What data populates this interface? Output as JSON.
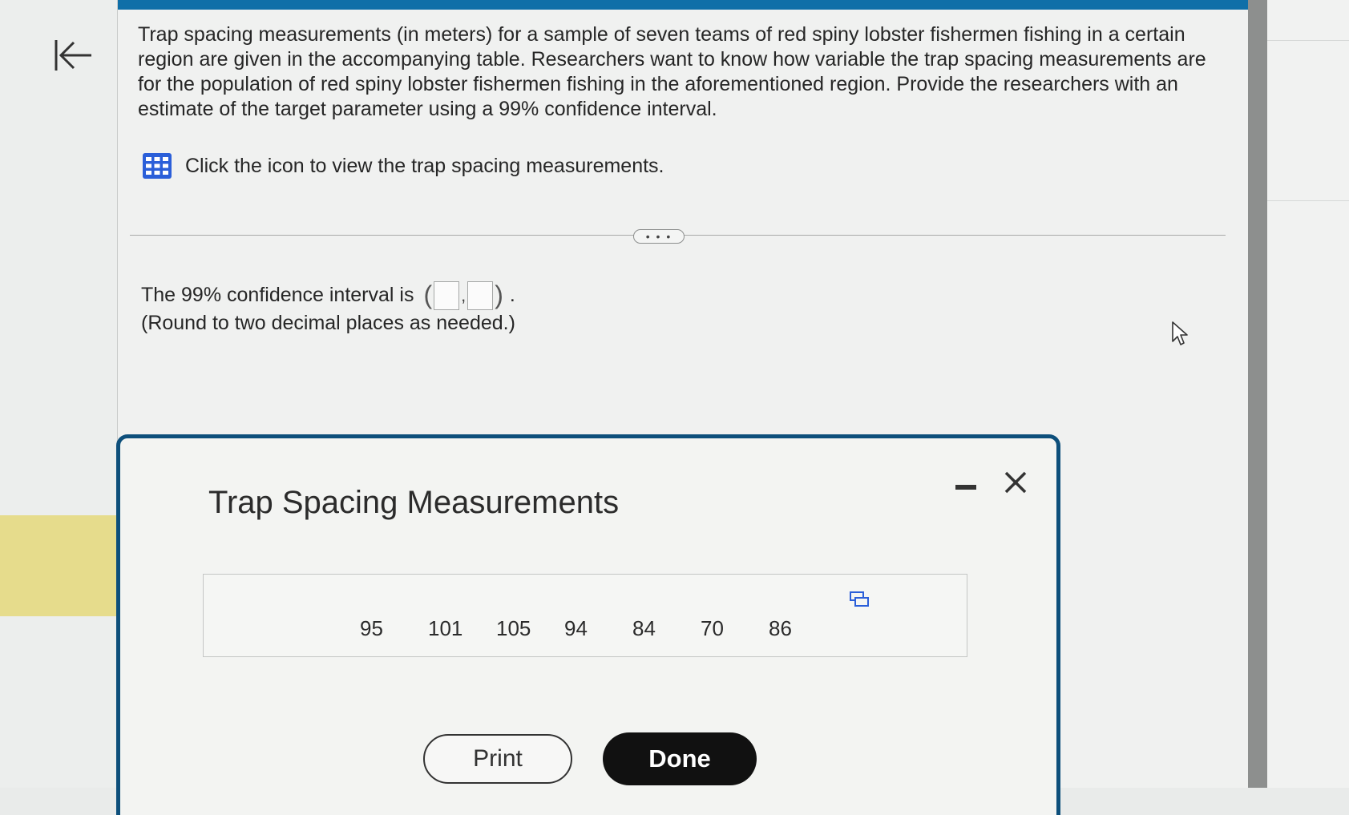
{
  "question": {
    "text": "Trap spacing measurements (in meters) for a sample of seven teams of red spiny lobster fishermen fishing in a certain region are given in the accompanying table. Researchers want to know how variable the trap spacing measurements are for the population of red spiny lobster fishermen fishing in the aforementioned region. Provide the researchers with an estimate of the target parameter using a 99% confidence interval.",
    "table_link": "Click the icon to view the trap spacing measurements."
  },
  "divider": {
    "expand_label": "• • •"
  },
  "answer": {
    "prompt": "The 99% confidence interval is",
    "open_paren": "(",
    "separator": ",",
    "close_paren": ")",
    "period": ".",
    "lower_value": "",
    "upper_value": "",
    "note": "(Round to two decimal places as needed.)"
  },
  "modal": {
    "title": "Trap Spacing Measurements",
    "measurements": [
      "95",
      "101",
      "105",
      "94",
      "84",
      "70",
      "86"
    ],
    "print_label": "Print",
    "done_label": "Done"
  },
  "colors": {
    "top_bar": "#0f6fa8",
    "modal_border": "#0d4f7b",
    "table_icon": "#2b5fd9",
    "highlight": "#e6dc8c",
    "done_button": "#111111"
  },
  "icons": {
    "back": "back-to-start-arrow-icon",
    "table": "grid-table-icon",
    "minimize": "minimize-icon",
    "close": "close-icon",
    "copy": "copy-icon",
    "cursor": "mouse-pointer-icon"
  }
}
